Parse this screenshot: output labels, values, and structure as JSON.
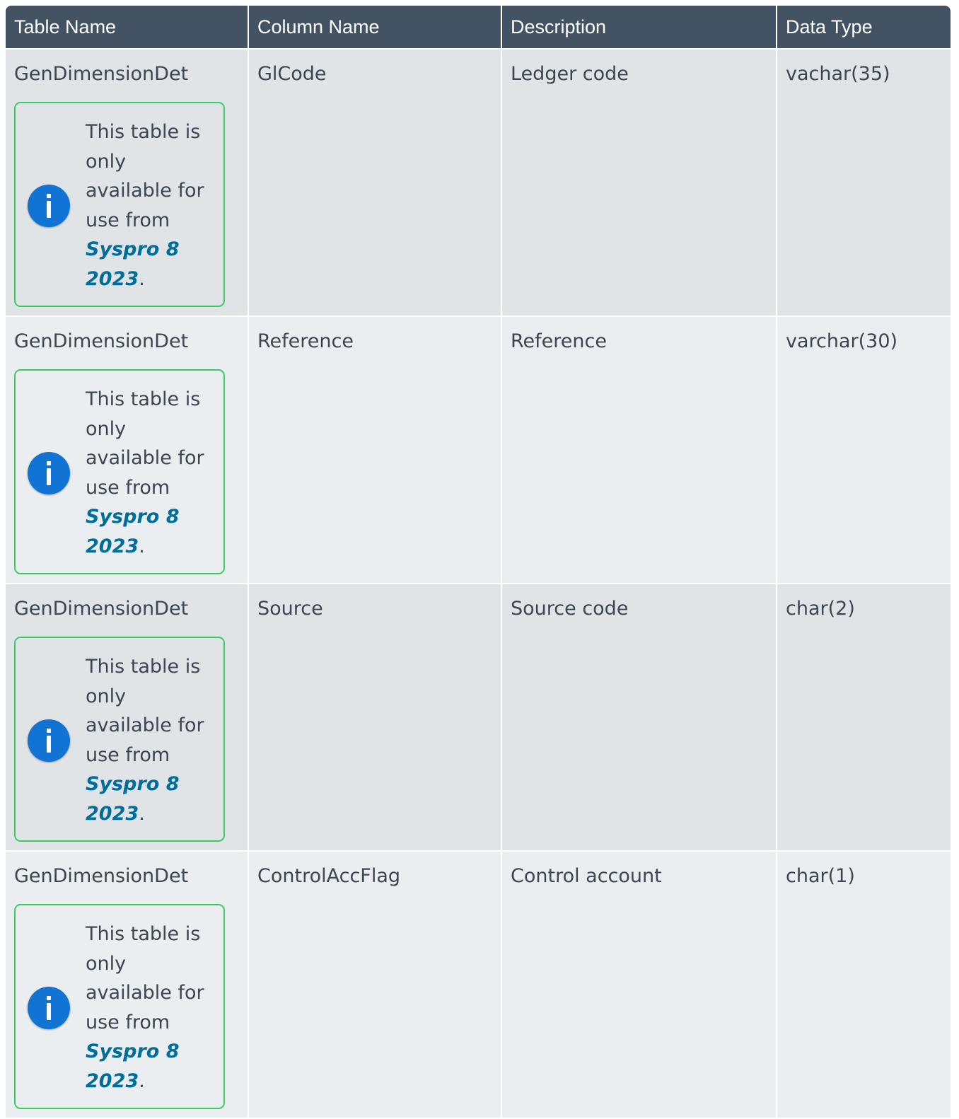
{
  "header": {
    "col1": "Table Name",
    "col2": "Column Name",
    "col3": "Description",
    "col4": "Data Type"
  },
  "rows": [
    {
      "table_name": "GenDimensionDet",
      "column_name": "GlCode",
      "description": "Ledger code",
      "data_type": "vachar(35)",
      "note": {
        "icon": "info-icon",
        "text": "This table is only available for use from ",
        "version": "Syspro 8 2023",
        "suffix": "."
      }
    },
    {
      "table_name": "GenDimensionDet",
      "column_name": "Reference",
      "description": "Reference",
      "data_type": "varchar(30)",
      "note": {
        "icon": "info-icon",
        "text": "This table is only available for use from ",
        "version": "Syspro 8 2023",
        "suffix": "."
      }
    },
    {
      "table_name": "GenDimensionDet",
      "column_name": "Source",
      "description": "Source code",
      "data_type": "char(2)",
      "note": {
        "icon": "info-icon",
        "text": "This table is only available for use from ",
        "version": "Syspro 8 2023",
        "suffix": "."
      }
    },
    {
      "table_name": "GenDimensionDet",
      "column_name": "ControlAccFlag",
      "description": "Control account",
      "data_type": "char(1)",
      "note": {
        "icon": "info-icon",
        "text": "This table is only available for use from ",
        "version": "Syspro 8 2023",
        "suffix": "."
      }
    }
  ],
  "colors": {
    "header_bg": "#435363",
    "row_odd_bg": "#e0e4e7",
    "row_even_bg": "#ebeef0",
    "note_border": "#3ccb63",
    "info_icon": "#1173d4",
    "version_text": "#006e9b"
  }
}
